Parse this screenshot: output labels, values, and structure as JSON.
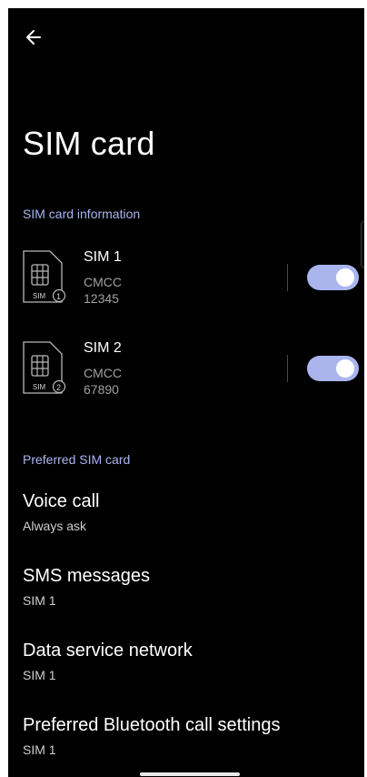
{
  "header": {
    "back_icon": "arrow-left-icon",
    "title": "SIM card"
  },
  "sim_info": {
    "section_label": "SIM card information",
    "sims": [
      {
        "name": "SIM 1",
        "carrier": "CMCC",
        "number": "12345",
        "icon_label": "SIM",
        "slot": "1",
        "enabled": true
      },
      {
        "name": "SIM 2",
        "carrier": "CMCC",
        "number": "67890",
        "icon_label": "SIM",
        "slot": "2",
        "enabled": true
      }
    ]
  },
  "preferred": {
    "section_label": "Preferred SIM card",
    "items": [
      {
        "title": "Voice call",
        "value": "Always ask"
      },
      {
        "title": "SMS messages",
        "value": "SIM 1"
      },
      {
        "title": "Data service network",
        "value": "SIM 1"
      },
      {
        "title": "Preferred Bluetooth call settings",
        "value": "SIM 1"
      }
    ]
  },
  "colors": {
    "background": "#000000",
    "accent": "#a9b4ef",
    "toggle_on": "#aab5ee",
    "secondary_text": "#a0a0a0"
  }
}
